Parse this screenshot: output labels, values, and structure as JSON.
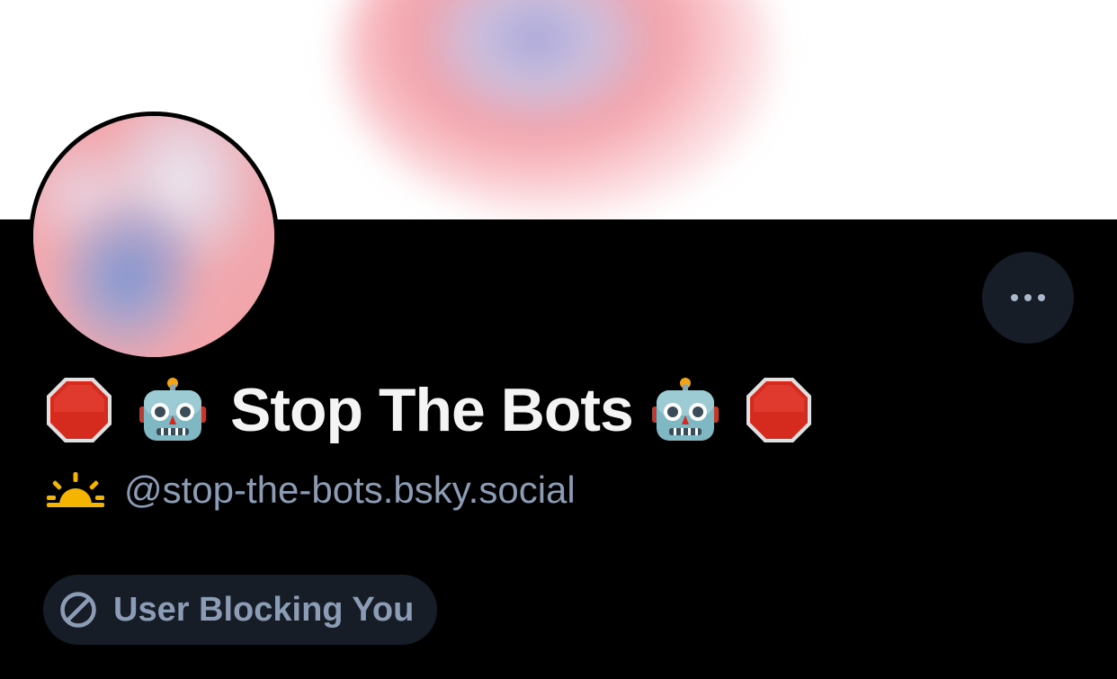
{
  "profile": {
    "display_name": "Stop The Bots",
    "handle": "@stop-the-bots.bsky.social",
    "name_prefix_icons": [
      "stop-sign-icon",
      "robot-icon"
    ],
    "name_suffix_icons": [
      "robot-icon",
      "stop-sign-icon"
    ],
    "handle_icon": "sunrise-icon"
  },
  "actions": {
    "more_icon": "ellipsis-icon"
  },
  "status": {
    "block_label": "User Blocking You",
    "block_icon": "block-icon"
  },
  "colors": {
    "background": "#000000",
    "button_bg": "#161d27",
    "muted_text": "#8c9cb4",
    "name_text": "#f4f4f5",
    "stop_red": "#d9271f",
    "sun_yellow": "#f5b400"
  }
}
